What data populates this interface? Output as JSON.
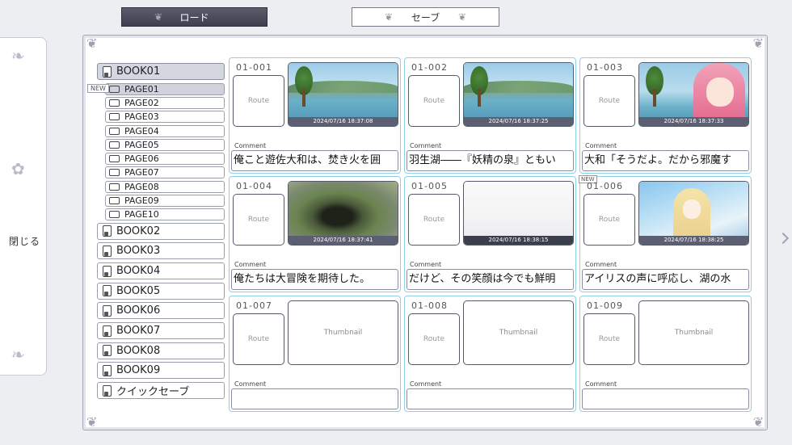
{
  "tabs": {
    "load_label": "ロード",
    "save_label": "セーブ"
  },
  "close_panel": {
    "label": "閉じる"
  },
  "books": [
    {
      "label": "BOOK01",
      "active": true
    },
    {
      "label": "BOOK02"
    },
    {
      "label": "BOOK03"
    },
    {
      "label": "BOOK04"
    },
    {
      "label": "BOOK05"
    },
    {
      "label": "BOOK06"
    },
    {
      "label": "BOOK07"
    },
    {
      "label": "BOOK08"
    },
    {
      "label": "BOOK09"
    },
    {
      "label": "クイックセーブ"
    }
  ],
  "pages": [
    "PAGE01",
    "PAGE02",
    "PAGE03",
    "PAGE04",
    "PAGE05",
    "PAGE06",
    "PAGE07",
    "PAGE08",
    "PAGE09",
    "PAGE10"
  ],
  "new_tag": "NEW",
  "route_label": "Route",
  "comment_label": "Comment",
  "thumbnail_placeholder": "Thumbnail",
  "slots": [
    {
      "number": "01-001",
      "date": "2024/07/16 18:37:08",
      "comment": "俺こと遊佐大和は、焚き火を囲"
    },
    {
      "number": "01-002",
      "date": "2024/07/16 18:37:25",
      "comment": "羽生湖――『妖精の泉』ともい"
    },
    {
      "number": "01-003",
      "date": "2024/07/16 18:37:33",
      "comment": "大和「そうだよ。だから邪魔す"
    },
    {
      "number": "01-004",
      "date": "2024/07/16 18:37:41",
      "comment": "俺たちは大冒険を期待した。"
    },
    {
      "number": "01-005",
      "date": "2024/07/16 18:38:15",
      "comment": "だけど、その笑顔は今でも鮮明"
    },
    {
      "number": "01-006",
      "date": "2024/07/16 18:38:25",
      "comment": "アイリスの声に呼応し、湖の水"
    },
    {
      "number": "01-007",
      "date": "",
      "comment": ""
    },
    {
      "number": "01-008",
      "date": "",
      "comment": ""
    },
    {
      "number": "01-009",
      "date": "",
      "comment": ""
    }
  ],
  "colors": {
    "slot_border": "#8fd0e8",
    "active_tab": "#4a4c5c",
    "panel_bg": "#ffffff"
  }
}
